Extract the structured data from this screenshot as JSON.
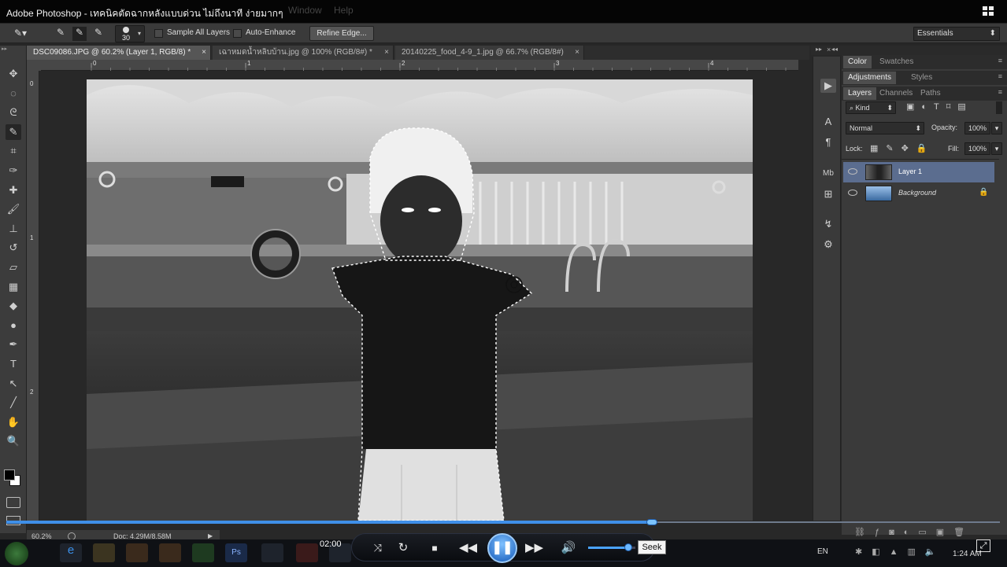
{
  "window": {
    "title": "Adobe Photoshop - เทคนิคตัดฉากหลังแบบด่วน ไม่ถึงนาที ง่ายมากๆ",
    "menu_faint": [
      "Window",
      "Help"
    ]
  },
  "options_bar": {
    "brush_size": "30",
    "sample_all_layers": "Sample All Layers",
    "auto_enhance": "Auto-Enhance",
    "refine_edge": "Refine Edge...",
    "workspace": "Essentials"
  },
  "doc_tabs": [
    {
      "label": "DSC09086.JPG @ 60.2% (Layer 1, RGB/8) *",
      "active": true
    },
    {
      "label": "เฉาหมดน้ำหลิบบ้าน.jpg @ 100% (RGB/8#) *",
      "active": false
    },
    {
      "label": "20140225_food_4-9_1.jpg @ 66.7% (RGB/8#)",
      "active": false
    }
  ],
  "ruler": {
    "top": [
      "0",
      "1",
      "2",
      "3",
      "4"
    ],
    "left": [
      "0",
      "1",
      "2"
    ]
  },
  "tools": [
    "move-icon",
    "marquee-icon",
    "lasso-icon",
    "quick-selection-icon",
    "crop-icon",
    "eyedropper-icon",
    "healing-icon",
    "brush-icon",
    "stamp-icon",
    "history-brush-icon",
    "eraser-icon",
    "gradient-icon",
    "blur-icon",
    "dodge-icon",
    "pen-icon",
    "type-icon",
    "path-selection-icon",
    "line-icon",
    "hand-icon",
    "zoom-icon"
  ],
  "tool_glyphs": [
    "✥",
    "◌",
    "ᘓ",
    "✎",
    "⌗",
    "✑",
    "✚",
    "🖌",
    "⊥",
    "↺",
    "▱",
    "▦",
    "◆",
    "●",
    "✒",
    "T",
    "↖",
    "╱",
    "✋",
    "🔍"
  ],
  "panels": {
    "group1": [
      "Color",
      "Swatches"
    ],
    "group2": [
      "Adjustments",
      "Styles"
    ],
    "group3": [
      "Layers",
      "Channels",
      "Paths"
    ],
    "filter_kind": "Kind",
    "blend_mode": "Normal",
    "opacity_label": "Opacity:",
    "opacity_value": "100%",
    "lock_label": "Lock:",
    "fill_label": "Fill:",
    "fill_value": "100%",
    "layers": [
      {
        "name": "Layer 1",
        "selected": true
      },
      {
        "name": "Background",
        "selected": false,
        "locked": true
      }
    ]
  },
  "status": {
    "zoom": "60.2%",
    "doc": "Doc: 4.29M/8.58M"
  },
  "player": {
    "time": "02:00",
    "tooltip": "Seek",
    "progress": 0.65,
    "volume": 0.85
  },
  "taskbar": {
    "lang": "EN",
    "clock": "1:24 AM"
  }
}
